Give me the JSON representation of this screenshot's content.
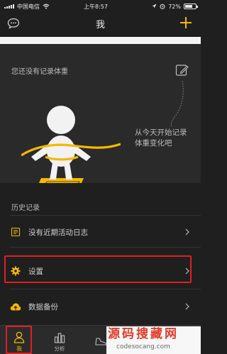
{
  "status_bar": {
    "carrier": "中国电信",
    "time": "上午8:57",
    "battery": "72%",
    "battery_level": 0.72
  },
  "nav": {
    "title": "我"
  },
  "weight": {
    "headline": "您还没有记录体重",
    "description": "从今天开始记录体重变化吧"
  },
  "history": {
    "section_title": "历史记录",
    "rows": [
      {
        "label": "没有近期活动日志"
      },
      {
        "label": "设置"
      },
      {
        "label": "数据备份"
      }
    ]
  },
  "tabbar": {
    "tabs": [
      {
        "label": "我"
      },
      {
        "label": "分析"
      },
      {
        "label": ""
      }
    ]
  },
  "watermark": {
    "title": "源码搜藏网",
    "url": "codesocang.com"
  },
  "colors": {
    "accent": "#f5b800",
    "highlight": "#e02020",
    "background": "#1f1f1f"
  }
}
